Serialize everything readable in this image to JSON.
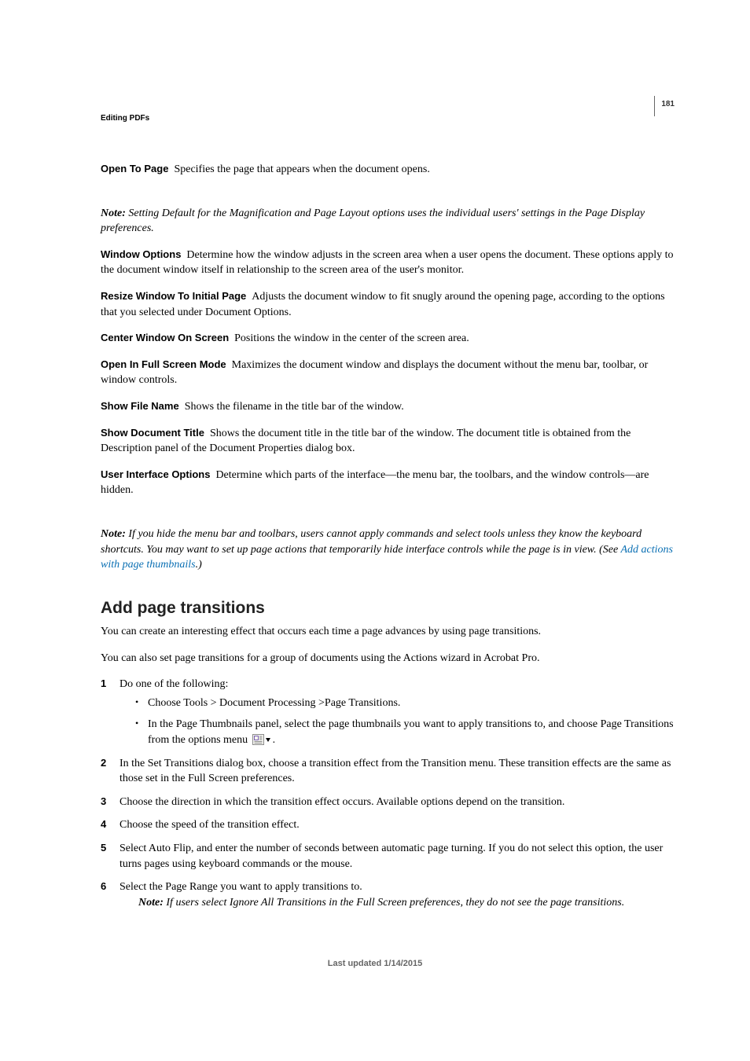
{
  "pageNumber": "181",
  "sectionLabel": "Editing PDFs",
  "defs": {
    "openToPage": {
      "term": "Open To Page",
      "text": "Specifies the page that appears when the document opens."
    },
    "windowOptions": {
      "term": "Window Options",
      "text": "Determine how the window adjusts in the screen area when a user opens the document. These options apply to the document window itself in relationship to the screen area of the user's monitor."
    },
    "resizeWindow": {
      "term": "Resize Window To Initial Page",
      "text": "Adjusts the document window to fit snugly around the opening page, according to the options that you selected under Document Options."
    },
    "centerWindow": {
      "term": "Center Window On Screen",
      "text": "Positions the window in the center of the screen area."
    },
    "fullScreen": {
      "term": "Open In Full Screen Mode",
      "text": "Maximizes the document window and displays the document without the menu bar, toolbar, or window controls."
    },
    "showFileName": {
      "term": "Show File Name",
      "text": "Shows the filename in the title bar of the window."
    },
    "showDocTitle": {
      "term": "Show Document Title",
      "text": "Shows the document title in the title bar of the window. The document title is obtained from the Description panel of the Document Properties dialog box."
    },
    "uiOptions": {
      "term": "User Interface Options",
      "text": "Determine which parts of the interface—the menu bar, the toolbars, and the window controls—are hidden."
    }
  },
  "notes": {
    "note1": {
      "label": "Note:",
      "text": "Setting Default for the Magnification and Page Layout options uses the individual users' settings in the Page Display preferences."
    },
    "note2": {
      "label": "Note:",
      "pre": "If you hide the menu bar and toolbars, users cannot apply commands and select tools unless they know the keyboard shortcuts. You may want to set up page actions that temporarily hide interface controls while the page is in view. (See ",
      "link": "Add actions with page thumbnails",
      "post": ".)"
    },
    "note3": {
      "label": "Note:",
      "text": "If users select Ignore All Transitions in the Full Screen preferences, they do not see the page transitions."
    }
  },
  "heading": "Add page transitions",
  "intro": {
    "p1": "You can create an interesting effect that occurs each time a page advances by using page transitions.",
    "p2": "You can also set page transitions for a group of documents using the Actions wizard in Acrobat Pro."
  },
  "steps": {
    "s1": "Do one of the following:",
    "s1a": "Choose Tools > Document Processing >Page Transitions.",
    "s1bPre": "In the Page Thumbnails panel, select the page thumbnails you want to apply transitions to, and choose Page Transitions from the options menu ",
    "s1bPost": ".",
    "s2": "In the Set Transitions dialog box, choose a transition effect from the Transition menu. These transition effects are the same as those set in the Full Screen preferences.",
    "s3": "Choose the direction in which the transition effect occurs. Available options depend on the transition.",
    "s4": "Choose the speed of the transition effect.",
    "s5": "Select Auto Flip, and enter the number of seconds between automatic page turning. If you do not select this option, the user turns pages using keyboard commands or the mouse.",
    "s6": "Select the Page Range you want to apply transitions to."
  },
  "footer": "Last updated 1/14/2015"
}
